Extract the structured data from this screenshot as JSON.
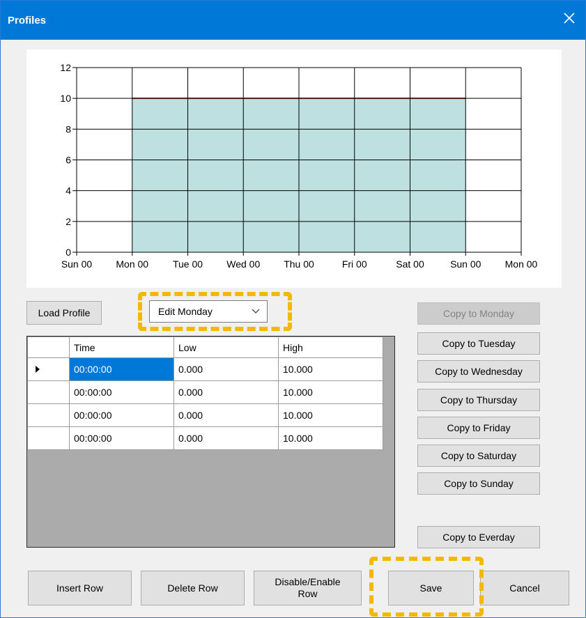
{
  "window": {
    "title": "Profiles"
  },
  "icons": {
    "close": "close-icon",
    "row_indicator": "row-indicator-icon",
    "dropdown": "chevron-down-icon"
  },
  "colors": {
    "titlebar": "#0078d7",
    "area_fill": "#bfe0e0",
    "profile_line": "#c8201a",
    "highlight": "#f5b800",
    "selected_cell": "#0078d7"
  },
  "chart_data": {
    "type": "area",
    "x_tick_labels": [
      "Sun 00",
      "Mon 00",
      "Tue 00",
      "Wed 00",
      "Thu 00",
      "Fri 00",
      "Sat 00",
      "Sun 00",
      "Mon 00"
    ],
    "y_tick_labels": [
      "0",
      "2",
      "4",
      "6",
      "8",
      "10",
      "12"
    ],
    "ylim": [
      0,
      12
    ],
    "grid": true,
    "series": [
      {
        "x_range": [
          "Mon 00",
          "Sun 00"
        ],
        "low": 0,
        "high": 10
      }
    ]
  },
  "controls": {
    "load_profile": "Load Profile",
    "day_select": "Edit Monday",
    "copy_buttons": [
      "Copy to Monday",
      "Copy to Tuesday",
      "Copy to Wednesday",
      "Copy to Thursday",
      "Copy to Friday",
      "Copy to Saturday",
      "Copy to Sunday"
    ],
    "copy_everyday": "Copy to Everday"
  },
  "grid": {
    "columns": [
      "Time",
      "Low",
      "High"
    ],
    "rows": [
      [
        "00:00:00",
        "0.000",
        "10.000"
      ],
      [
        "00:00:00",
        "0.000",
        "10.000"
      ],
      [
        "00:00:00",
        "0.000",
        "10.000"
      ],
      [
        "00:00:00",
        "0.000",
        "10.000"
      ]
    ]
  },
  "footer": {
    "insert_row": "Insert Row",
    "delete_row": "Delete Row",
    "disable_enable_row_line1": "Disable/Enable",
    "disable_enable_row_line2": "Row",
    "save": "Save",
    "cancel": "Cancel"
  }
}
